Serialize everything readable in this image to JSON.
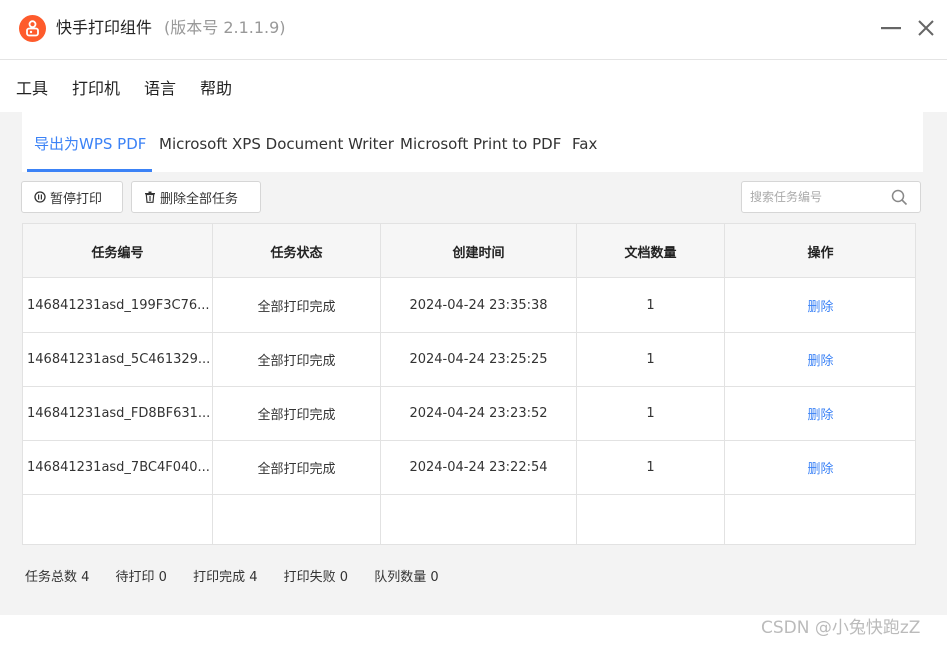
{
  "window": {
    "title": "快手打印组件",
    "version": "(版本号 2.1.1.9)",
    "brand_color": "#fe5b2c"
  },
  "menu": [
    "工具",
    "打印机",
    "语言",
    "帮助"
  ],
  "tabs": [
    {
      "label": "导出为WPS PDF",
      "active": true
    },
    {
      "label": "Microsoft XPS Document Writer",
      "active": false
    },
    {
      "label": "Microsoft Print to PDF",
      "active": false
    },
    {
      "label": "Fax",
      "active": false
    }
  ],
  "toolbar": {
    "pause_label": "暂停打印",
    "delete_all_label": "删除全部任务",
    "search_placeholder": "搜索任务编号"
  },
  "table": {
    "headers": [
      "任务编号",
      "任务状态",
      "创建时间",
      "文档数量",
      "操作"
    ],
    "rows": [
      {
        "id": "146841231asd_199F3C76...",
        "status": "全部打印完成",
        "created": "2024-04-24 23:35:38",
        "count": "1",
        "action": "删除"
      },
      {
        "id": "146841231asd_5C461329...",
        "status": "全部打印完成",
        "created": "2024-04-24 23:25:25",
        "count": "1",
        "action": "删除"
      },
      {
        "id": "146841231asd_FD8BF631...",
        "status": "全部打印完成",
        "created": "2024-04-24 23:23:52",
        "count": "1",
        "action": "删除"
      },
      {
        "id": "146841231asd_7BC4F040...",
        "status": "全部打印完成",
        "created": "2024-04-24 23:22:54",
        "count": "1",
        "action": "删除"
      }
    ]
  },
  "footer": {
    "total": "任务总数 4",
    "pending": "待打印 0",
    "done": "打印完成 4",
    "failed": "打印失败 0",
    "queue": "队列数量 0"
  },
  "watermark": "CSDN @小兔快跑zZ",
  "colors": {
    "accent": "#3b82f6"
  }
}
